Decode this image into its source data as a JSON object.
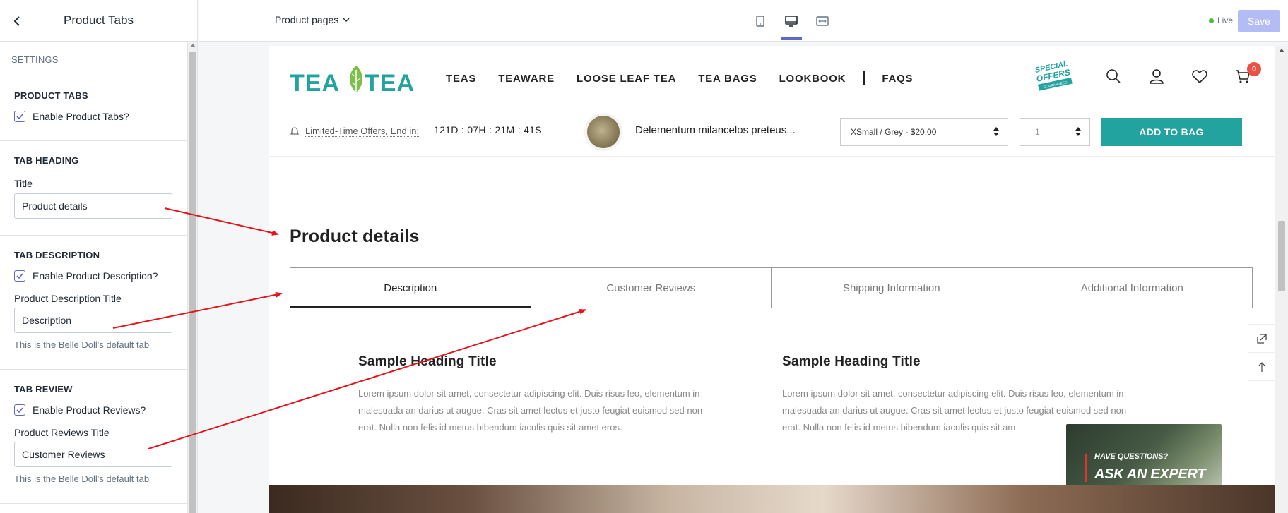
{
  "sidebar": {
    "title": "Product Tabs",
    "settings_caption": "SETTINGS",
    "product_tabs": {
      "heading": "PRODUCT TABS",
      "enable_label": "Enable Product Tabs?"
    },
    "tab_heading": {
      "heading": "TAB HEADING",
      "title_label": "Title",
      "title_value": "Product details"
    },
    "tab_description": {
      "heading": "TAB DESCRIPTION",
      "enable_label": "Enable Product Description?",
      "title_label": "Product Description Title",
      "title_value": "Description",
      "help": "This is the Belle Doll's default tab"
    },
    "tab_review": {
      "heading": "TAB REVIEW",
      "enable_label": "Enable Product Reviews?",
      "title_label": "Product Reviews Title",
      "title_value": "Customer Reviews",
      "help": "This is the Belle Doll's default tab"
    }
  },
  "topbar": {
    "page_selector": "Product pages",
    "devices": [
      "mobile-icon",
      "desktop-icon",
      "full-width-icon"
    ],
    "live_label": "Live",
    "save_label": "Save"
  },
  "store": {
    "nav": [
      "TEAS",
      "TEAWARE",
      "LOOSE LEAF TEA",
      "TEA BAGS",
      "LOOKBOOK",
      "FAQS"
    ],
    "badge_line1": "SPECIAL",
    "badge_line2": "OFFERS",
    "badge_line3": "GUARANTEED",
    "cart_count": "0",
    "offer_text": "Limited-Time Offers, End in:",
    "countdown": "121D : 07H : 21M : 41S",
    "product_name": "Delementum milancelos preteus...",
    "variant": "XSmall / Grey - $20.00",
    "quantity": "1",
    "add_to_bag": "ADD TO BAG",
    "section_title": "Product details",
    "tabs": [
      {
        "label": "Description",
        "active": true
      },
      {
        "label": "Customer Reviews",
        "active": false
      },
      {
        "label": "Shipping Information",
        "active": false
      },
      {
        "label": "Additional Information",
        "active": false
      }
    ],
    "columns": [
      {
        "heading": "Sample Heading Title",
        "body": "Lorem ipsum dolor sit amet, consectetur adipiscing elit. Duis risus leo, elementum in malesuada an darius ut augue. Cras sit amet lectus et justo feugiat euismod sed non erat. Nulla non felis id metus bibendum iaculis quis sit amet eros."
      },
      {
        "heading": "Sample Heading Title",
        "body": "Lorem ipsum dolor sit amet, consectetur adipiscing elit. Duis risus leo, elementum in malesuada an darius ut augue. Cras sit amet lectus et justo feugiat euismod sed non erat. Nulla non felis id metus bibendum iaculis quis sit am"
      }
    ],
    "expert_line1": "HAVE QUESTIONS?",
    "expert_line2": "ASK AN EXPERT"
  },
  "colors": {
    "accent": "#5c6ac4",
    "brand_teal": "#22a39f",
    "cart_badge": "#e95144",
    "annotation_arrow": "#e3141b"
  }
}
